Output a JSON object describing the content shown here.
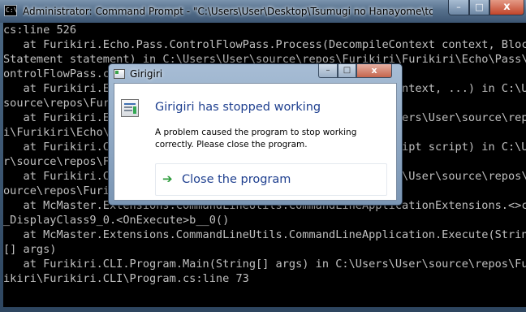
{
  "console": {
    "title": "Administrator: Command Prompt - \"C:\\Users\\User\\Desktop\\Tsumugi no Hanayome\\tools\\furikiri.cli...",
    "icon": "cmd-icon",
    "controls": {
      "minimize": "–",
      "maximize": "□",
      "close": "x"
    },
    "lines": [
      "cs:line 526",
      "   at Furikiri.Echo.Pass.ControlFlowPass.Process(DecompileContext context, Block",
      "Statement statement) in C:\\Users\\User\\source\\repos\\Furikiri\\Furikiri\\Echo\\Pass\\C",
      "ontrolFlowPass.cs:line 30",
      "   at Furikiri.Echo.Decompiler.Decompile(DecompileContext context, ...) in C:\\Users\\User\\",
      "source\\repos\\Furikiri\\Furikiri\\Echo\\Decompiler.cs:line 83",
      "   at Furikiri.Echo.Decompiler.DecompileObject(...) in C:\\Users\\User\\source\\repos\\Furiki",
      "i\\Furikiri\\Echo\\Decompiler.cs:line 52",
      "   at Furikiri.CLI.Program.<>c.<Main>b__0_0(... context, Script script) in C:\\Users\\Use",
      "r\\source\\repos\\Furikiri\\Furikiri.CLI\\Program.cs:line 40",
      "   at Furikiri.CLI.Program.<>c.<Main>b__0_1(...) in C:\\Users\\User\\source\\repos\\Furikiri\\",
      "ource\\repos\\Furikiri\\Furikiri.CLI\\Program.cs:line 60",
      "   at McMaster.Extensions.CommandLineUtils.CommandLineApplicationExtensions.<>c__",
      "_DisplayClass9_0.<OnExecute>b__0()",
      "   at McMaster.Extensions.CommandLineUtils.CommandLineApplication.Execute(String",
      "[] args)",
      "   at Furikiri.CLI.Program.Main(String[] args) in C:\\Users\\User\\source\\repos\\Fur",
      "ikiri\\Furikiri.CLI\\Program.cs:line 73"
    ]
  },
  "dialog": {
    "title": "Girigiri",
    "controls": {
      "minimize": "–",
      "maximize": "□",
      "close": "x"
    },
    "heading": "Girigiri has stopped working",
    "message": "A problem caused the program to stop working correctly. Please close the program.",
    "action_icon": "green-arrow-icon",
    "action_label": "Close the program"
  },
  "colors": {
    "console_bg": "#000000",
    "console_text": "#c0c0c0",
    "dialog_heading": "#1e3f8f",
    "action_arrow": "#2b9b3a",
    "close_button": "#c4654d"
  }
}
